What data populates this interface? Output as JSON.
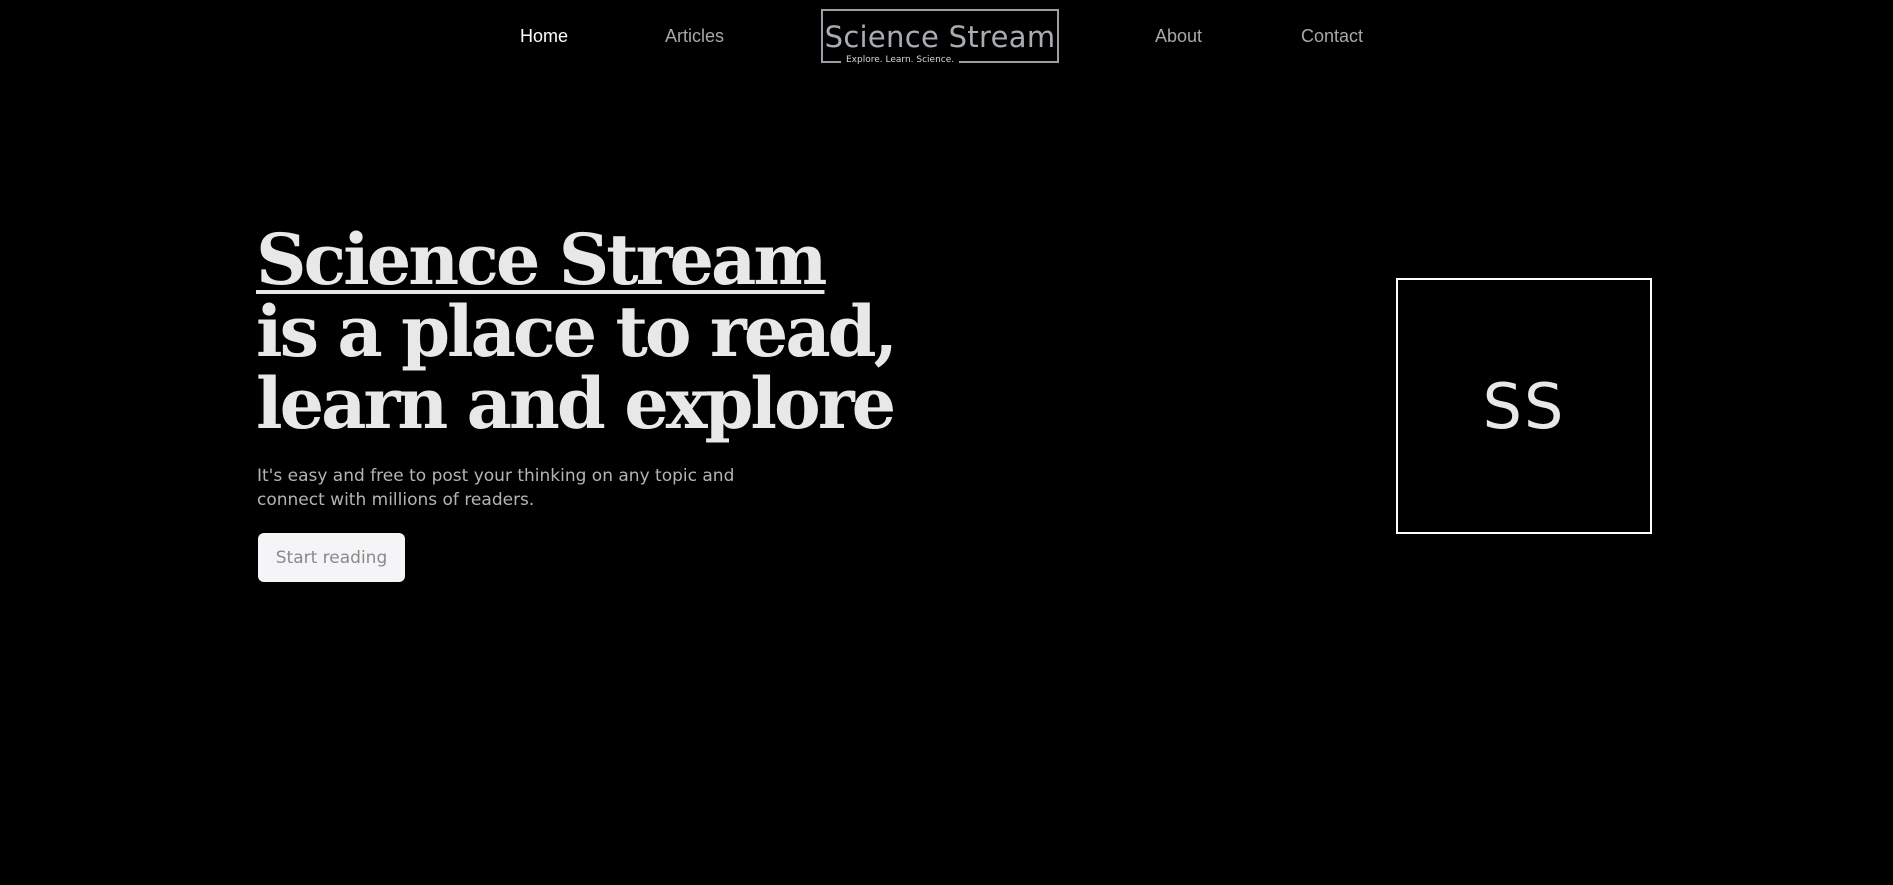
{
  "nav": {
    "home": "Home",
    "articles": "Articles",
    "about": "About",
    "contact": "Contact"
  },
  "logo": {
    "title": "Science Stream",
    "tagline": "Explore. Learn. Science."
  },
  "hero": {
    "title_line1": "Science Stream",
    "title_line2": "is a place to read,",
    "title_line3": "learn and explore",
    "subtitle": "It's easy and free to post your thinking on any topic and connect with millions of readers.",
    "cta_label": "Start reading"
  },
  "badge": {
    "text": "SS"
  },
  "colors": {
    "background": "#000000",
    "nav_active": "#ffffff",
    "nav_inactive": "#a8a8a8",
    "button_bg": "#f5f5f7"
  }
}
